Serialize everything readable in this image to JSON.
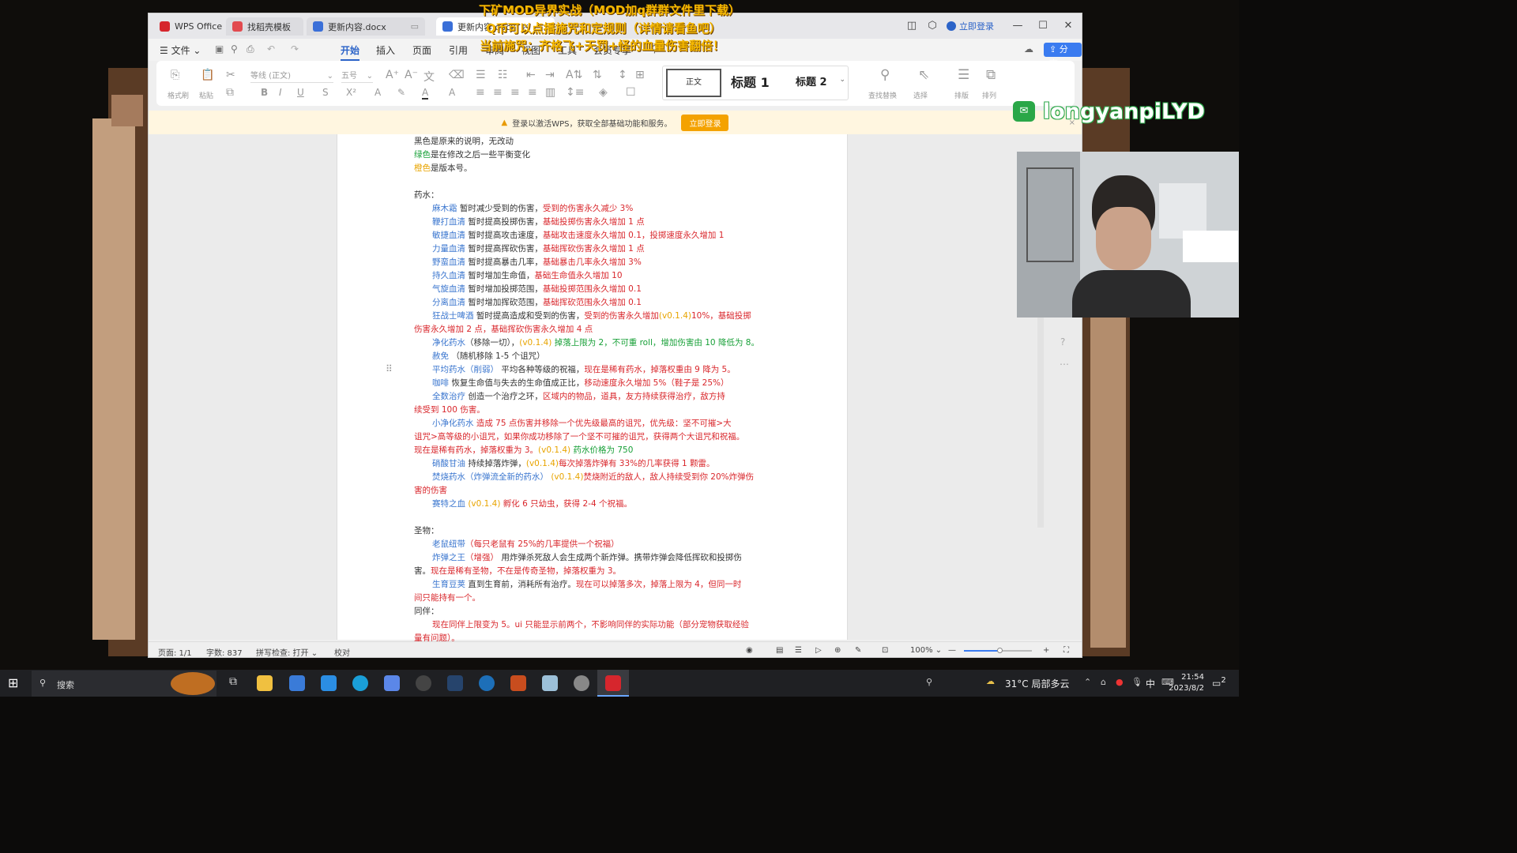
{
  "window_tabs": [
    {
      "label": "WPS Office",
      "color": "#d6262d"
    },
    {
      "label": "找稻壳模板",
      "color": "#e24a4f"
    },
    {
      "label": "更新内容.docx",
      "color": "#3a6fd8"
    },
    {
      "label": "更新内容.docx",
      "color": "#3a6fd8"
    }
  ],
  "login_label": "立即登录",
  "menu": {
    "file": "文件",
    "items": [
      "开始",
      "插入",
      "页面",
      "引用",
      "审阅",
      "视图",
      "工具",
      "会员专享"
    ],
    "active": "开始",
    "share": "分享"
  },
  "ribbon": {
    "font_name": "等线 (正文)",
    "font_size": "五号",
    "style_normal": "正文",
    "style_h1": "标题 1",
    "style_h2": "标题 2",
    "format_painter": "格式刷",
    "paste": "粘贴",
    "find_replace": "查找替换",
    "select": "选择",
    "layout": "排版",
    "arrange": "排列"
  },
  "notice": {
    "text": "登录以激活WPS，获取全部基础功能和服务。",
    "button": "立即登录"
  },
  "doc": [
    [
      {
        "c": "k",
        "t": "黑色是原来的说明，无改动"
      }
    ],
    [
      {
        "c": "g",
        "t": "绿色"
      },
      {
        "c": "k",
        "t": "是在修改之后一些平衡变化"
      }
    ],
    [
      {
        "c": "o",
        "t": "橙色"
      },
      {
        "c": "k",
        "t": "是版本号。"
      }
    ],
    [],
    [
      {
        "c": "k",
        "t": "药水："
      }
    ],
    [
      {
        "c": "b",
        "t": "麻木霜"
      },
      {
        "c": "k",
        "t": "      暂时减少受到的伤害，"
      },
      {
        "c": "r",
        "t": "受到的伤害永久减少 3%"
      }
    ],
    [
      {
        "c": "b",
        "t": "鞭打血清"
      },
      {
        "c": "k",
        "t": "      暂时提高投掷伤害，"
      },
      {
        "c": "r",
        "t": "基础投掷伤害永久增加 1 点"
      }
    ],
    [
      {
        "c": "b",
        "t": "敏捷血清"
      },
      {
        "c": "k",
        "t": "      暂时提高攻击速度，"
      },
      {
        "c": "r",
        "t": "基础攻击速度永久增加 0.1，投掷速度永久增加 1"
      }
    ],
    [
      {
        "c": "b",
        "t": "力量血清"
      },
      {
        "c": "k",
        "t": "      暂时提高挥砍伤害，"
      },
      {
        "c": "r",
        "t": "基础挥砍伤害永久增加 1 点"
      }
    ],
    [
      {
        "c": "b",
        "t": "野蛮血清"
      },
      {
        "c": "k",
        "t": "      暂时提高暴击几率，"
      },
      {
        "c": "r",
        "t": "基础暴击几率永久增加 3%"
      }
    ],
    [
      {
        "c": "b",
        "t": "持久血清"
      },
      {
        "c": "k",
        "t": "      暂时增加生命值，"
      },
      {
        "c": "r",
        "t": "基础生命值永久增加 10"
      }
    ],
    [
      {
        "c": "b",
        "t": "气旋血清"
      },
      {
        "c": "k",
        "t": "      暂时增加投掷范围，"
      },
      {
        "c": "r",
        "t": "基础投掷范围永久增加 0.1"
      }
    ],
    [
      {
        "c": "b",
        "t": "分离血清"
      },
      {
        "c": "k",
        "t": "      暂时增加挥砍范围，"
      },
      {
        "c": "r",
        "t": "基础挥砍范围永久增加 0.1"
      }
    ],
    [
      {
        "c": "b",
        "t": "狂战士啤酒"
      },
      {
        "c": "k",
        "t": "      暂时提高造成和受到的伤害，"
      },
      {
        "c": "r",
        "t": "受到的伤害永久增加"
      },
      {
        "c": "o",
        "t": "(v0.1.4)"
      },
      {
        "c": "r",
        "t": "10%，基础投掷"
      }
    ],
    [
      {
        "c": "r",
        "t": "伤害永久增加 2 点，基础挥砍伤害永久增加 4 点"
      }
    ],
    [
      {
        "c": "b",
        "t": "净化药水"
      },
      {
        "c": "k",
        "t": "（移除一切），"
      },
      {
        "c": "o",
        "t": "(v0.1.4)"
      },
      {
        "c": "g",
        "t": " 掉落上限为 2，不可重 roll，增加伤害由 10 降低为 8。"
      }
    ],
    [
      {
        "c": "b",
        "t": "赦免"
      },
      {
        "c": "k",
        "t": "      （随机移除 1-5 个诅咒）"
      }
    ],
    [
      {
        "c": "b",
        "t": "平均药水（削弱）"
      },
      {
        "c": "k",
        "t": "    平均各种等级的祝福，"
      },
      {
        "c": "r",
        "t": "现在是稀有药水，掉落权重由 9 降为 5。"
      }
    ],
    [
      {
        "c": "b",
        "t": "咖啡"
      },
      {
        "c": "k",
        "t": "          恢复生命值与失去的生命值成正比，"
      },
      {
        "c": "r",
        "t": "移动速度永久增加 5%（鞋子是 25%）"
      }
    ],
    [
      {
        "c": "b",
        "t": "全数治疗"
      },
      {
        "c": "k",
        "t": "        创造一个治疗之环，"
      },
      {
        "c": "r",
        "t": "区域内的物品，道具，友方持续获得治疗，敌方持"
      }
    ],
    [
      {
        "c": "r",
        "t": "续受到 100 伤害。"
      }
    ],
    [
      {
        "c": "b",
        "t": "小净化药水"
      },
      {
        "c": "r",
        "t": "       造成  75  点伤害并移除一个优先级最高的诅咒，优先级：坚不可摧>大"
      }
    ],
    [
      {
        "c": "r",
        "t": "诅咒>高等级的小诅咒，如果你成功移除了一个坚不可摧的诅咒，获得两个大诅咒和祝福。"
      }
    ],
    [
      {
        "c": "r",
        "t": "现在是稀有药水，掉落权重为 3。"
      },
      {
        "c": "o",
        "t": "(v0.1.4)"
      },
      {
        "c": "g",
        "t": " 药水价格为 750"
      }
    ],
    [
      {
        "c": "b",
        "t": "硝酸甘油"
      },
      {
        "c": "k",
        "t": " 持续掉落炸弹，"
      },
      {
        "c": "o",
        "t": "(v0.1.4)"
      },
      {
        "c": "r",
        "t": "每次掉落炸弹有 33%的几率获得 1 颗雷。"
      }
    ],
    [
      {
        "c": "b",
        "t": "焚烧药水（炸弹流全新的药水）"
      },
      {
        "c": "o",
        "t": " (v0.1.4)"
      },
      {
        "c": "r",
        "t": "焚烧附近的敌人，敌人持续受到你 20%炸弹伤"
      }
    ],
    [
      {
        "c": "r",
        "t": "害的伤害"
      }
    ],
    [
      {
        "c": "b",
        "t": "赛特之血"
      },
      {
        "c": "o",
        "t": " (v0.1.4) "
      },
      {
        "c": "r",
        "t": "孵化 6 只幼虫，获得 2-4 个祝福。"
      }
    ],
    [],
    [
      {
        "c": "k",
        "t": "圣物："
      }
    ],
    [
      {
        "c": "b",
        "t": "老鼠纽带"
      },
      {
        "c": "r",
        "t": "（每只老鼠有 25%的几率提供一个祝福）"
      }
    ],
    [
      {
        "c": "b",
        "t": "炸弹之王"
      },
      {
        "c": "r",
        "t": "（增强）"
      },
      {
        "c": "k",
        "t": "  用炸弹杀死敌人会生成两个新炸弹。携带炸弹会降低挥砍和投掷伤"
      }
    ],
    [
      {
        "c": "k",
        "t": "害。"
      },
      {
        "c": "r",
        "t": "现在是稀有圣物，不在是传奇圣物，掉落权重为 3。"
      }
    ],
    [
      {
        "c": "b",
        "t": "生育豆荚"
      },
      {
        "c": "k",
        "t": " 直到生育前，消耗所有治疗。"
      },
      {
        "c": "r",
        "t": "现在可以掉落多次，掉落上限为 4，但同一时"
      }
    ],
    [
      {
        "c": "r",
        "t": "间只能持有一个。"
      }
    ],
    [
      {
        "c": "k",
        "t": "同伴："
      }
    ],
    [
      {
        "c": "r",
        "t": "现在同伴上限变为 5。ui 只能显示前两个，不影响同伴的实际功能（部分宠物获取经验"
      }
    ],
    [
      {
        "c": "r",
        "t": "量有问题）。"
      }
    ]
  ],
  "indent_rows": [
    5,
    6,
    7,
    8,
    9,
    10,
    11,
    12,
    13,
    15,
    16,
    17,
    18,
    19,
    21,
    24,
    25,
    27,
    30,
    31,
    33,
    36
  ],
  "status": {
    "page": "页面: 1/1",
    "words": "字数: 837",
    "spell": "拼写检查: 打开",
    "proof": "校对",
    "zoom": "100%"
  },
  "overlay": {
    "line1": "下矿MOD异界实战（MOD加q群群文件里下载）",
    "line2": "Q币可以点播施咒和定规则（详情请看鱼吧）",
    "line3": "当前施咒：齐格飞+天罚+怪的血量伤害翻倍！"
  },
  "wechat": {
    "name": "longyanpiLYD"
  },
  "taskbar": {
    "search": "搜索",
    "weather": "31°C 局部多云",
    "time": "21:54",
    "date": "2023/8/2",
    "ime": "中",
    "notif": "2"
  }
}
